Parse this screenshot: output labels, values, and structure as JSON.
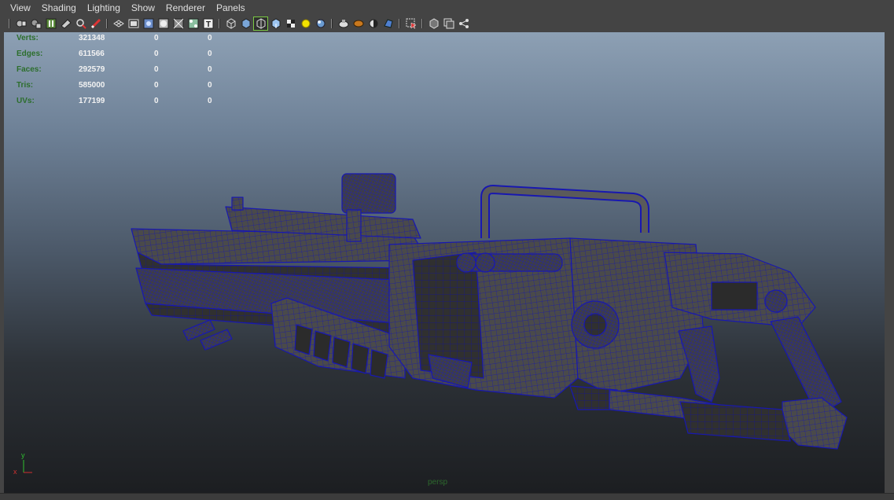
{
  "menu": {
    "items": [
      "View",
      "Shading",
      "Lighting",
      "Show",
      "Renderer",
      "Panels"
    ]
  },
  "toolbar": {
    "icons": [
      "camera-select-icon",
      "camera-attributes-icon",
      "bookmark-icon",
      "image-plane-icon",
      "2d-pan-zoom-icon",
      "grease-pencil-icon",
      "grid-icon",
      "film-gate-icon",
      "resolution-gate-icon",
      "gate-mask-icon",
      "field-chart-icon",
      "safe-title-icon",
      "wireframe-icon",
      "smooth-shade-icon",
      "wireframe-on-shaded-icon",
      "textured-icon",
      "use-all-lights-icon",
      "shadows-icon",
      "ambient-occlusion-icon",
      "motion-blur-icon",
      "anti-aliasing-icon",
      "depth-of-field-icon",
      "isolate-select-icon",
      "xray-icon",
      "xray-joints-icon",
      "xray-active-components-icon"
    ]
  },
  "hud": {
    "rows": [
      {
        "label": "Verts:",
        "values": [
          "321348",
          "0",
          "0"
        ]
      },
      {
        "label": "Edges:",
        "values": [
          "611566",
          "0",
          "0"
        ]
      },
      {
        "label": "Faces:",
        "values": [
          "292579",
          "0",
          "0"
        ]
      },
      {
        "label": "Tris:",
        "values": [
          "585000",
          "0",
          "0"
        ]
      },
      {
        "label": "UVs:",
        "values": [
          "177199",
          "0",
          "0"
        ]
      }
    ]
  },
  "viewport": {
    "camera": "persp",
    "axis_y": "y",
    "axis_x": "x"
  },
  "colors": {
    "ui_bg": "#444444",
    "menu_text": "#e0e0e0",
    "hud_label": "#2c6e2c",
    "hud_value": "#f2f2f2",
    "wire": "#1a1aa8",
    "mesh": "#4a4a4a",
    "toolbar_active": "#7ac943"
  }
}
